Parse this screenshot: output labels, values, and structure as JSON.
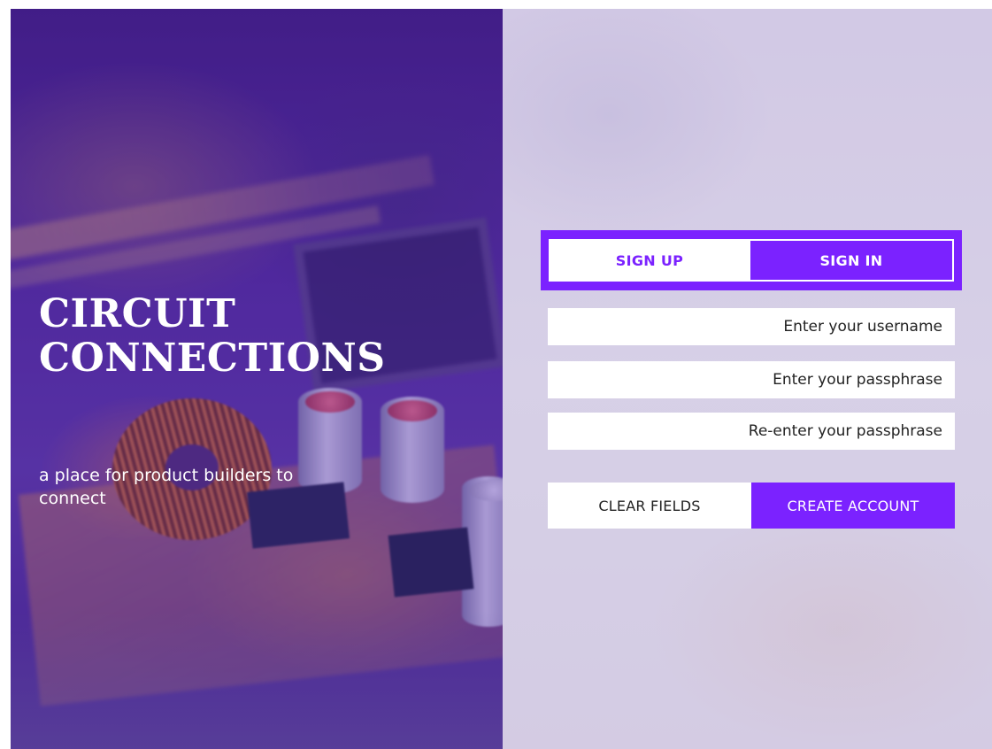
{
  "hero": {
    "title_line1": "CIRCUIT",
    "title_line2": "CONNECTIONS",
    "tagline": "a place for product builders to connect"
  },
  "auth": {
    "tabs": [
      {
        "label": "SIGN UP",
        "active": true
      },
      {
        "label": "SIGN IN",
        "active": false
      }
    ],
    "fields": {
      "username_placeholder": "Enter your username",
      "passphrase_placeholder": "Enter your passphrase",
      "confirm_placeholder": "Re-enter your passphrase"
    },
    "buttons": {
      "clear_label": "CLEAR FIELDS",
      "create_label": "CREATE ACCOUNT"
    }
  },
  "colors": {
    "accent": "#7b22ff",
    "form_background": "#d4cee3",
    "hero_overlay": "#4e2a92"
  }
}
